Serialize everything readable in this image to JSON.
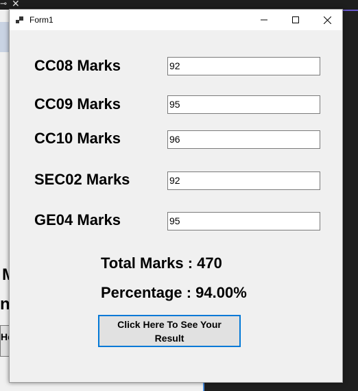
{
  "window": {
    "title": "Form1"
  },
  "form": {
    "fields": [
      {
        "label": "CC08 Marks",
        "value": "92"
      },
      {
        "label": "CC09 Marks",
        "value": "95"
      },
      {
        "label": "CC10 Marks",
        "value": "96"
      },
      {
        "label": "SEC02 Marks",
        "value": "92"
      },
      {
        "label": "GE04 Marks",
        "value": "95"
      }
    ],
    "total_text": "Total Marks : 470",
    "percentage_text": "Percentage : 94.00%",
    "button_label": "Click Here To See Your Result"
  },
  "background": {
    "partial_text1": "M",
    "partial_text2": "n",
    "partial_button": "He"
  },
  "colors": {
    "accent": "#0078d7",
    "form_bg": "#f0f0f0"
  }
}
